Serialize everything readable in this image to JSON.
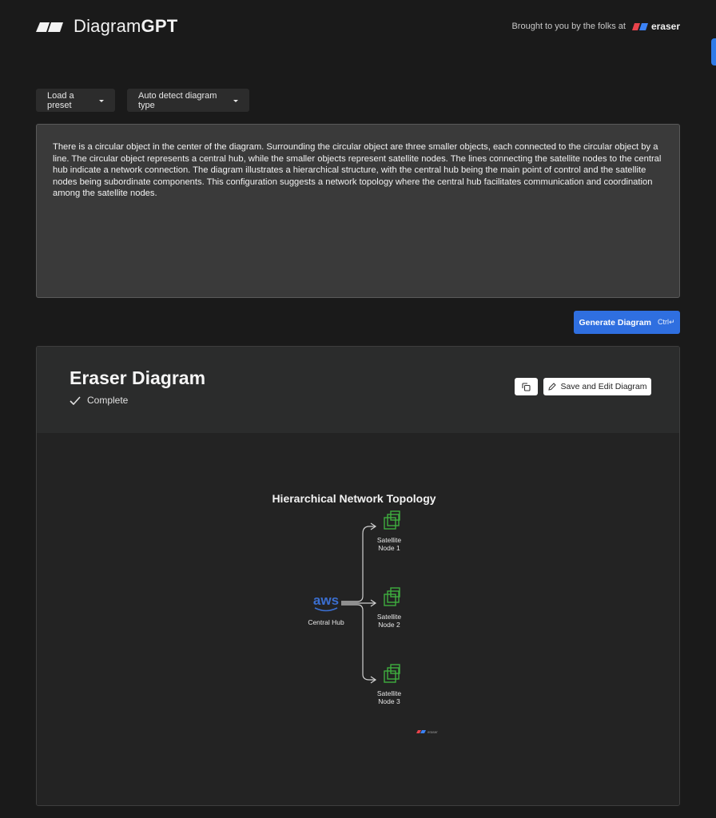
{
  "header": {
    "brand_light": "Diagram",
    "brand_bold": "GPT",
    "attribution": "Brought to you by the folks at",
    "eraser_label": "eraser"
  },
  "controls": {
    "preset_label": "Load a preset",
    "diagram_type_label": "Auto detect diagram type"
  },
  "prompt": {
    "text": "There is a circular object in the center of the diagram. Surrounding the circular object are three smaller objects, each connected to the circular object by a line. The circular object represents a central hub, while the smaller objects represent satellite nodes. The lines connecting the satellite nodes to the central hub indicate a network connection. The diagram illustrates a hierarchical structure, with the central hub being the main point of control and the satellite nodes being subordinate components. This configuration suggests a network topology where the central hub facilitates communication and coordination among the satellite nodes."
  },
  "generate": {
    "label": "Generate Diagram",
    "shortcut": "Ctrl↵"
  },
  "result": {
    "title": "Eraser Diagram",
    "status": "Complete",
    "save_label": "Save and Edit Diagram"
  },
  "diagram": {
    "title": "Hierarchical Network Topology",
    "hub_logo": "aws",
    "hub_label": "Central Hub",
    "nodes": [
      {
        "line1": "Satellite",
        "line2": "Node 1"
      },
      {
        "line1": "Satellite",
        "line2": "Node 2"
      },
      {
        "line1": "Satellite",
        "line2": "Node 3"
      }
    ],
    "watermark": "eraser"
  },
  "colors": {
    "accent": "#2f6fe0",
    "node_green": "#3fae3f",
    "aws_blue": "#3b6fd1",
    "eraser_red": "#e8434b",
    "eraser_blue": "#3b82f6"
  },
  "icons": [
    "logo-mark-icon",
    "eraser-logo-icon",
    "caret-down-icon",
    "check-icon",
    "copy-icon",
    "pencil-icon",
    "aws-icon",
    "ec2-node-icon"
  ]
}
